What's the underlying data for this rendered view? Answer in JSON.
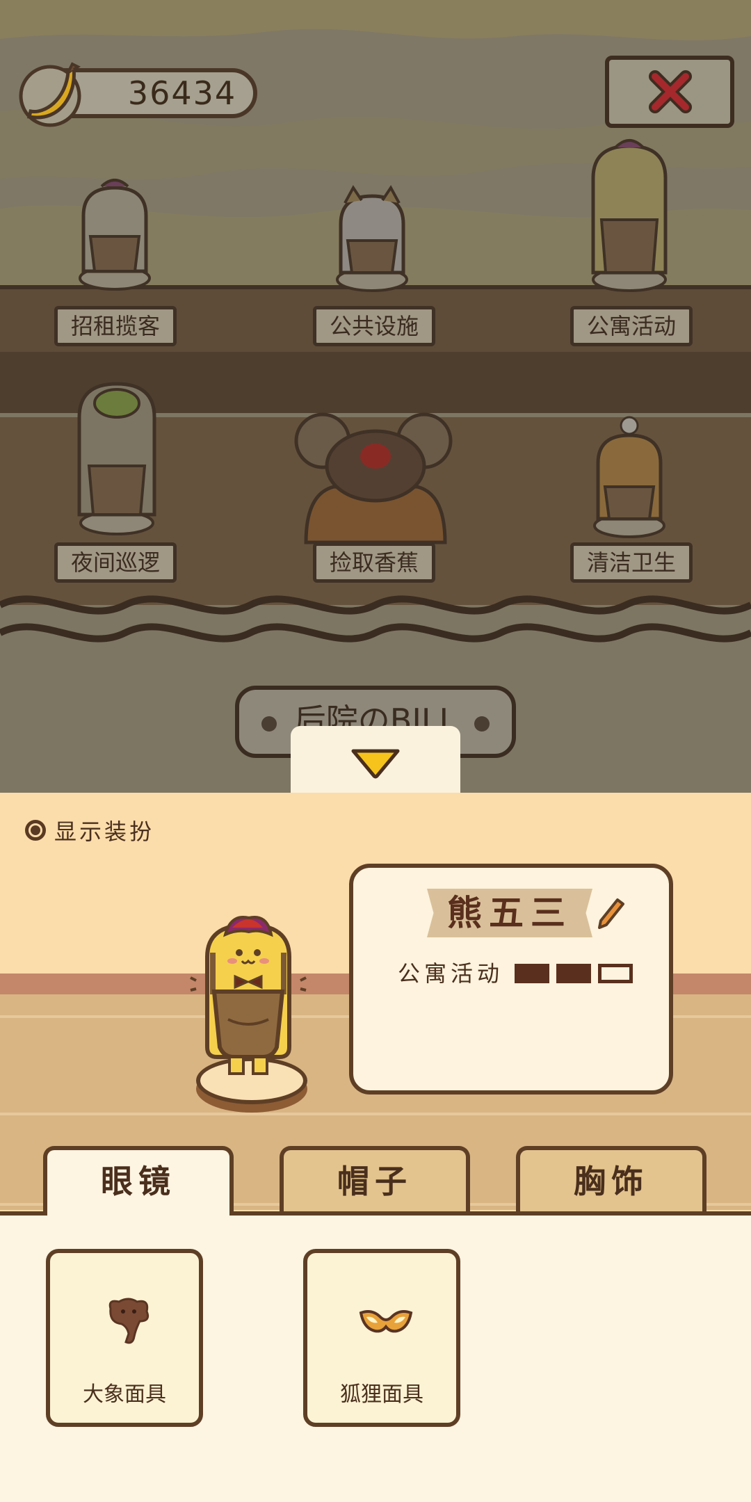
{
  "currency": {
    "icon": "banana-icon",
    "amount": "36434"
  },
  "close": {
    "icon": "close-x-icon",
    "color": "#c2272d"
  },
  "jobs": [
    {
      "label": "招租揽客"
    },
    {
      "label": "公共设施"
    },
    {
      "label": "公寓活动"
    },
    {
      "label": "夜间巡逻"
    },
    {
      "label": "捡取香蕉"
    },
    {
      "label": "清洁卫生"
    }
  ],
  "sign": {
    "text": "后院のBILL"
  },
  "collapse": {
    "icon": "chevron-down-icon",
    "color": "#f5c31b"
  },
  "outfit_toggle": {
    "label": "显示装扮",
    "checked": true
  },
  "character": {
    "name": "熊五三",
    "job": "公寓活动",
    "level": 2,
    "max_level": 3
  },
  "tabs": [
    {
      "label": "眼镜",
      "active": true
    },
    {
      "label": "帽子",
      "active": false
    },
    {
      "label": "胸饰",
      "active": false
    }
  ],
  "items": [
    {
      "label": "大象面具",
      "icon": "elephant-mask-icon"
    },
    {
      "label": "狐狸面具",
      "icon": "fox-mask-icon"
    }
  ]
}
